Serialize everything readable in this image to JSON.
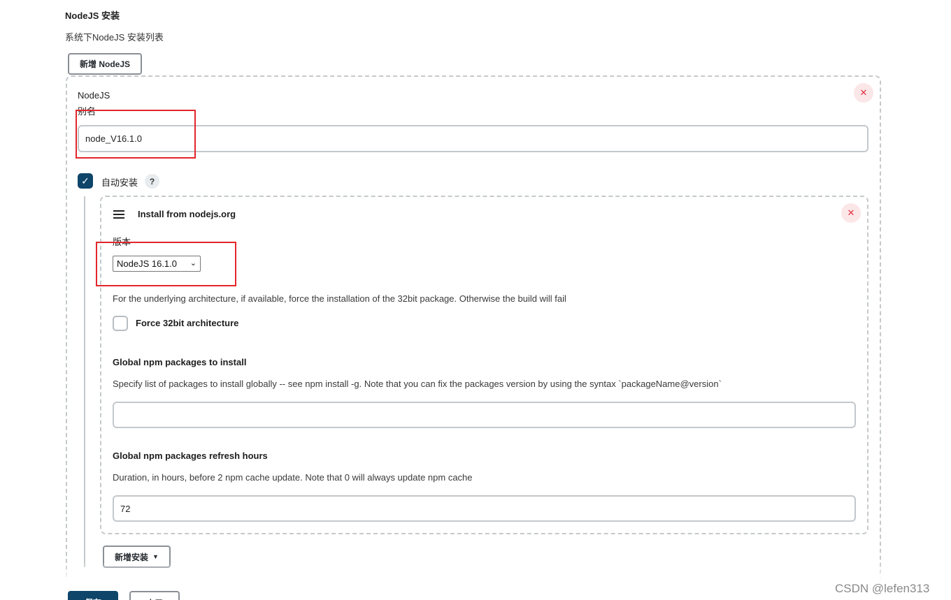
{
  "section": {
    "title": "NodeJS 安装",
    "description": "系统下NodeJS 安装列表",
    "add_button": "新增 NodeJS"
  },
  "nodejs_entry": {
    "heading": "NodeJS",
    "alias_label": "别名",
    "alias_value": "node_V16.1.0",
    "close_glyph": "✕",
    "auto_install": {
      "checked": true,
      "label": "自动安装",
      "help": "?"
    },
    "installer": {
      "title": "Install from nodejs.org",
      "version_label": "版本",
      "version_selected": "NodeJS 16.1.0",
      "arch_description": "For the underlying architecture, if available, force the installation of the 32bit package. Otherwise the build will fail",
      "force_32bit_label": "Force 32bit architecture",
      "force_32bit_checked": false,
      "npm_packages_title": "Global npm packages to install",
      "npm_packages_description": "Specify list of packages to install globally -- see npm install -g. Note that you can fix the packages version by using the syntax `packageName@version`",
      "npm_packages_value": "",
      "refresh_title": "Global npm packages refresh hours",
      "refresh_description": "Duration, in hours, before 2 npm cache update. Note that 0 will always update npm cache",
      "refresh_value": "72"
    },
    "add_installer_button": "新增安装"
  },
  "footer": {
    "save_button": "保存",
    "apply_button": "应用"
  },
  "watermark": "CSDN @lefen313",
  "colors": {
    "primary": "#0f4569",
    "danger": "#e2313f",
    "annotation_red": "#e3262b"
  }
}
